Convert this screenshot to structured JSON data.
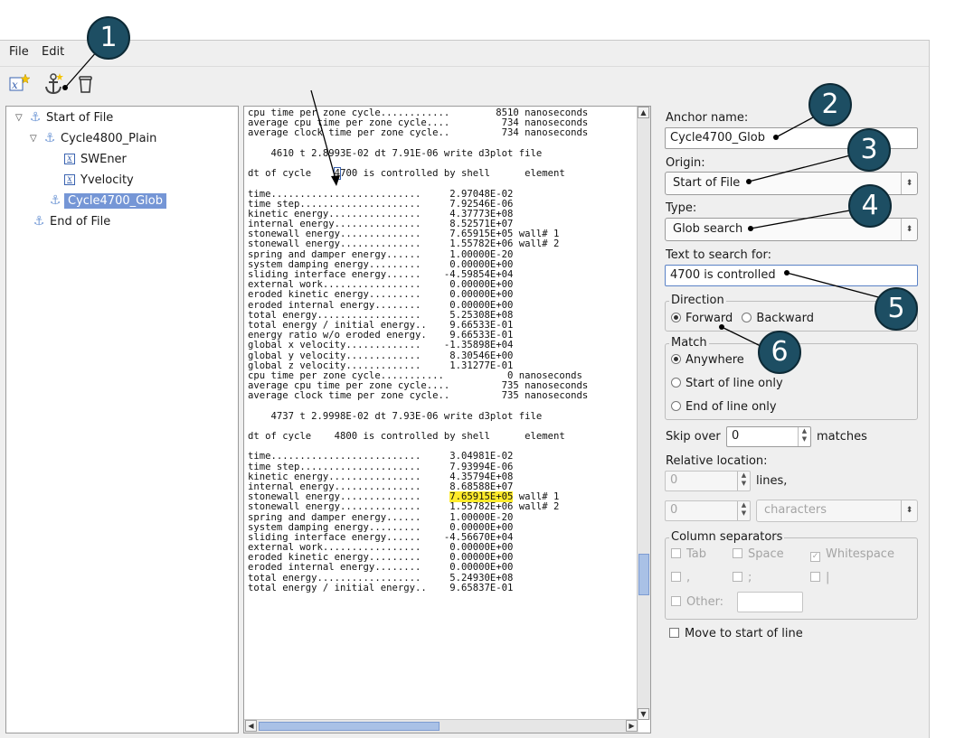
{
  "menu": {
    "file": "File",
    "edit": "Edit"
  },
  "toolbar": {
    "x_icon": "x-star-icon",
    "anchor_icon": "anchor-add-icon",
    "trash_icon": "trash-icon"
  },
  "tree": {
    "start": "Start of File",
    "cycle4800": "Cycle4800_Plain",
    "swener": "SWEner",
    "yvelocity": "Yvelocity",
    "cycle4700": "Cycle4700_Glob",
    "end": "End of File"
  },
  "text_lines": [
    "cpu time per zone cycle............        8510 nanoseconds",
    "average cpu time per zone cycle....         734 nanoseconds",
    "average clock time per zone cycle..         734 nanoseconds",
    "",
    "    4610 t 2.8993E-02 dt 7.91E-06 write d3plot file",
    "",
    "dt of cycle    4700 is controlled by shell      element",
    "",
    "time..........................     2.97048E-02",
    "time step.....................     7.92546E-06",
    "kinetic energy................     4.37773E+08",
    "internal energy...............     8.52571E+07",
    "stonewall energy..............     7.65915E+05 wall# 1",
    "stonewall energy..............     1.55782E+06 wall# 2",
    "spring and damper energy......     1.00000E-20",
    "system damping energy.........     0.00000E+00",
    "sliding interface energy......    -4.59854E+04",
    "external work.................     0.00000E+00",
    "eroded kinetic energy.........     0.00000E+00",
    "eroded internal energy........     0.00000E+00",
    "total energy..................     5.25308E+08",
    "total energy / initial energy..    9.66533E-01",
    "energy ratio w/o eroded energy.    9.66533E-01",
    "global x velocity.............    -1.35898E+04",
    "global y velocity.............     8.30546E+00",
    "global z velocity.............     1.31277E-01",
    "cpu time per zone cycle...........           0 nanoseconds",
    "average cpu time per zone cycle....         735 nanoseconds",
    "average clock time per zone cycle..         735 nanoseconds",
    "",
    "    4737 t 2.9998E-02 dt 7.93E-06 write d3plot file",
    "",
    "dt of cycle    4800 is controlled by shell      element",
    "",
    "time..........................     3.04981E-02",
    "time step.....................     7.93994E-06",
    "kinetic energy................     4.35794E+08",
    "internal energy...............     8.68588E+07",
    "stonewall energy..............     7.65915E+05 wall# 1",
    "stonewall energy..............     1.55782E+06 wall# 2",
    "spring and damper energy......     1.00000E-20",
    "system damping energy.........     0.00000E+00",
    "sliding interface energy......    -4.56670E+04",
    "external work.................     0.00000E+00",
    "eroded kinetic energy.........     0.00000E+00",
    "eroded internal energy........     0.00000E+00",
    "total energy..................     5.24930E+08",
    "total energy / initial energy..    9.65837E-01"
  ],
  "panel": {
    "anchor_name_label": "Anchor name:",
    "anchor_name_value": "Cycle4700_Glob",
    "origin_label": "Origin:",
    "origin_value": "Start of File",
    "type_label": "Type:",
    "type_value": "Glob search",
    "search_label": "Text to search for:",
    "search_value": "4700 is controlled",
    "direction_title": "Direction",
    "forward": "Forward",
    "backward": "Backward",
    "match_title": "Match",
    "anywhere": "Anywhere",
    "start_of_line": "Start of line only",
    "end_of_line": "End of line only",
    "skip_over": "Skip over",
    "skip_value": "0",
    "matches": "matches",
    "relative_location": "Relative location:",
    "lines_value": "0",
    "lines": "lines,",
    "chars_value": "0",
    "characters": "characters",
    "column_separators": "Column separators",
    "tab": "Tab",
    "space": "Space",
    "whitespace": "Whitespace",
    "comma": ",",
    "semicolon": ";",
    "pipe": "|",
    "other": "Other:",
    "move_to_start": "Move to start of line"
  },
  "callouts": [
    "1",
    "2",
    "3",
    "4",
    "5",
    "6"
  ],
  "colors": {
    "callout": "#1d4e63",
    "selection": "#7596d6",
    "highlight": "#ffeb2a"
  }
}
